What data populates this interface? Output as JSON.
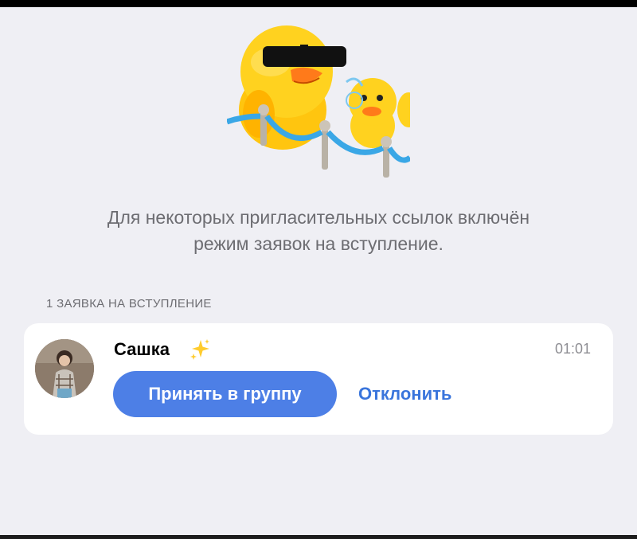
{
  "info": {
    "line1": "Для некоторых пригласительных ссылок включён",
    "line2": "режим заявок на вступление."
  },
  "requests": {
    "header": "1 ЗАЯВКА НА ВСТУПЛЕНИЕ",
    "items": [
      {
        "name": "Сашка",
        "time": "01:01",
        "accept_label": "Принять в группу",
        "decline_label": "Отклонить"
      }
    ]
  },
  "colors": {
    "accent": "#4d7fe6",
    "link": "#3a75dc",
    "background": "#efeff4",
    "card": "#ffffff"
  },
  "icons": {
    "sticker": "duck-sticker-icon",
    "sparkle": "sparkles-icon"
  }
}
